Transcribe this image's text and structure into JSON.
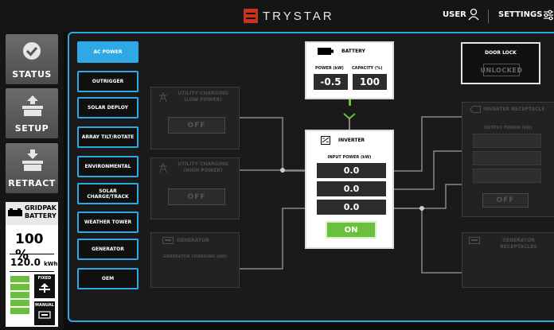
{
  "header": {
    "brand": "TRYSTAR",
    "user_label": "USER",
    "settings_label": "SETTINGS"
  },
  "nav": {
    "status": "STATUS",
    "setup": "SETUP",
    "retract": "RETRACT"
  },
  "gridpak": {
    "title_line1": "GRIDPAK",
    "title_line2": "BATTERY",
    "percent": "100 %",
    "energy_value": "120.0",
    "energy_unit": "kWh",
    "level_bars": 5,
    "mode_fixed": "FIXED",
    "mode_manual": "MANUAL"
  },
  "menu": [
    {
      "label": "AC POWER",
      "active": true
    },
    {
      "label": "OUTRIGGER",
      "active": false
    },
    {
      "label": "SOLAR DEPLOY",
      "active": false
    },
    {
      "label": "ARRAY TILT/ROTATE",
      "active": false
    },
    {
      "label": "ENVIRONMENTAL",
      "active": false
    },
    {
      "label": "SOLAR CHARGE/TRACK",
      "active": false
    },
    {
      "label": "WEATHER TOWER",
      "active": false
    },
    {
      "label": "GENERATOR",
      "active": false
    },
    {
      "label": "OEM",
      "active": false
    }
  ],
  "utility_low": {
    "title_line1": "UTILITY CHARGING",
    "title_line2": "(LOW POWER)",
    "button": "OFF"
  },
  "utility_high": {
    "title_line1": "UTILITY CHARGING",
    "title_line2": "(HIGH POWER)",
    "button": "OFF"
  },
  "generator": {
    "title": "GENERATOR",
    "subtitle": "GENERATOR CHARGING (kW)"
  },
  "battery": {
    "title": "BATTERY",
    "power_label": "POWER (kW)",
    "capacity_label": "CAPACITY (%)",
    "power_value": "-0.5",
    "capacity_value": "100"
  },
  "inverter": {
    "title": "INVERTER",
    "input_label": "INPUT POWER (kW)",
    "values": [
      "0.0",
      "0.0",
      "0.0"
    ],
    "button": "ON"
  },
  "door_lock": {
    "title": "DOOR LOCK",
    "state": "UNLOCKED"
  },
  "inverter_receptacle": {
    "title": "INVERTER RECEPTACLE",
    "output_label": "OUTPUT POWER (kW)",
    "button": "OFF"
  },
  "generator_receptacles": {
    "title": "GENERATOR RECEPTACLES"
  },
  "colors": {
    "accent": "#2ea9e6",
    "on_green": "#6abf3c",
    "brand_red": "#c8341f"
  }
}
